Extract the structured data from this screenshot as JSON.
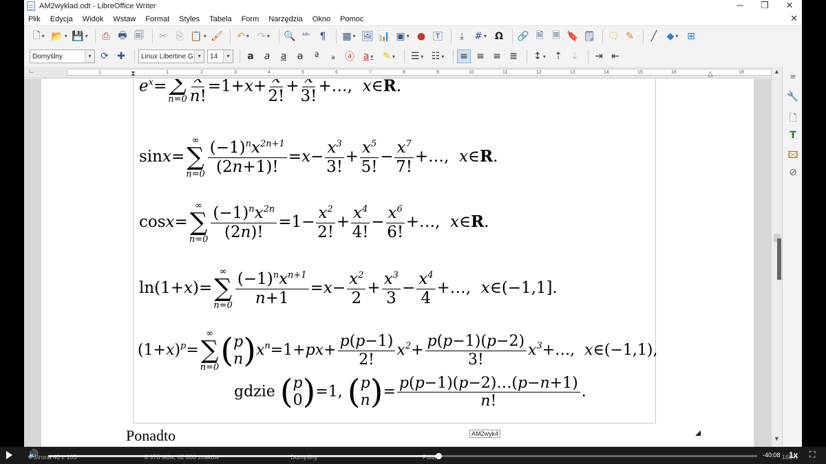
{
  "window": {
    "title": "AM2wyklad.odt - LibreOffice Writer",
    "minimize": "─",
    "maximize": "❐",
    "close": "✕",
    "doc_close": "✕"
  },
  "menu": [
    "Plik",
    "Edycja",
    "Widok",
    "Wstaw",
    "Format",
    "Styles",
    "Tabela",
    "Form",
    "Narzędzia",
    "Okno",
    "Pomoc"
  ],
  "toolbar2": {
    "paragraph_style": "Domyślny",
    "font_name": "Linux Libertine G",
    "font_size": "14"
  },
  "ruler": {
    "labels": [
      "1",
      "1",
      "2",
      "3",
      "4",
      "5",
      "6",
      "7",
      "8",
      "9",
      "10",
      "11",
      "12",
      "13",
      "14",
      "15",
      "16",
      "18"
    ]
  },
  "document": {
    "formulas": [
      {
        "lhs": "e",
        "lhs_sup": "x",
        "rest": "= 1 + x + … , x ∈ R."
      },
      {
        "lhs": "sin x"
      },
      {
        "lhs": "cos x"
      },
      {
        "lhs": "ln(1+x)"
      },
      {
        "lhs": "(1+x)"
      }
    ],
    "gdzie": "gdzie",
    "tooltip": "AM2wyk4",
    "next_heading": "Ponadto"
  },
  "status": {
    "page": "Strona 48 z 105",
    "words": "8 978 słów, 62 806 znaków",
    "style": "Domyślny",
    "language": "Polski",
    "zoom": "168%"
  },
  "player": {
    "time": "-40:08",
    "speed": "1x",
    "progress": 0.55
  },
  "colors": {
    "accent": "#3a5a8a",
    "selection": "#cfe0f3"
  }
}
